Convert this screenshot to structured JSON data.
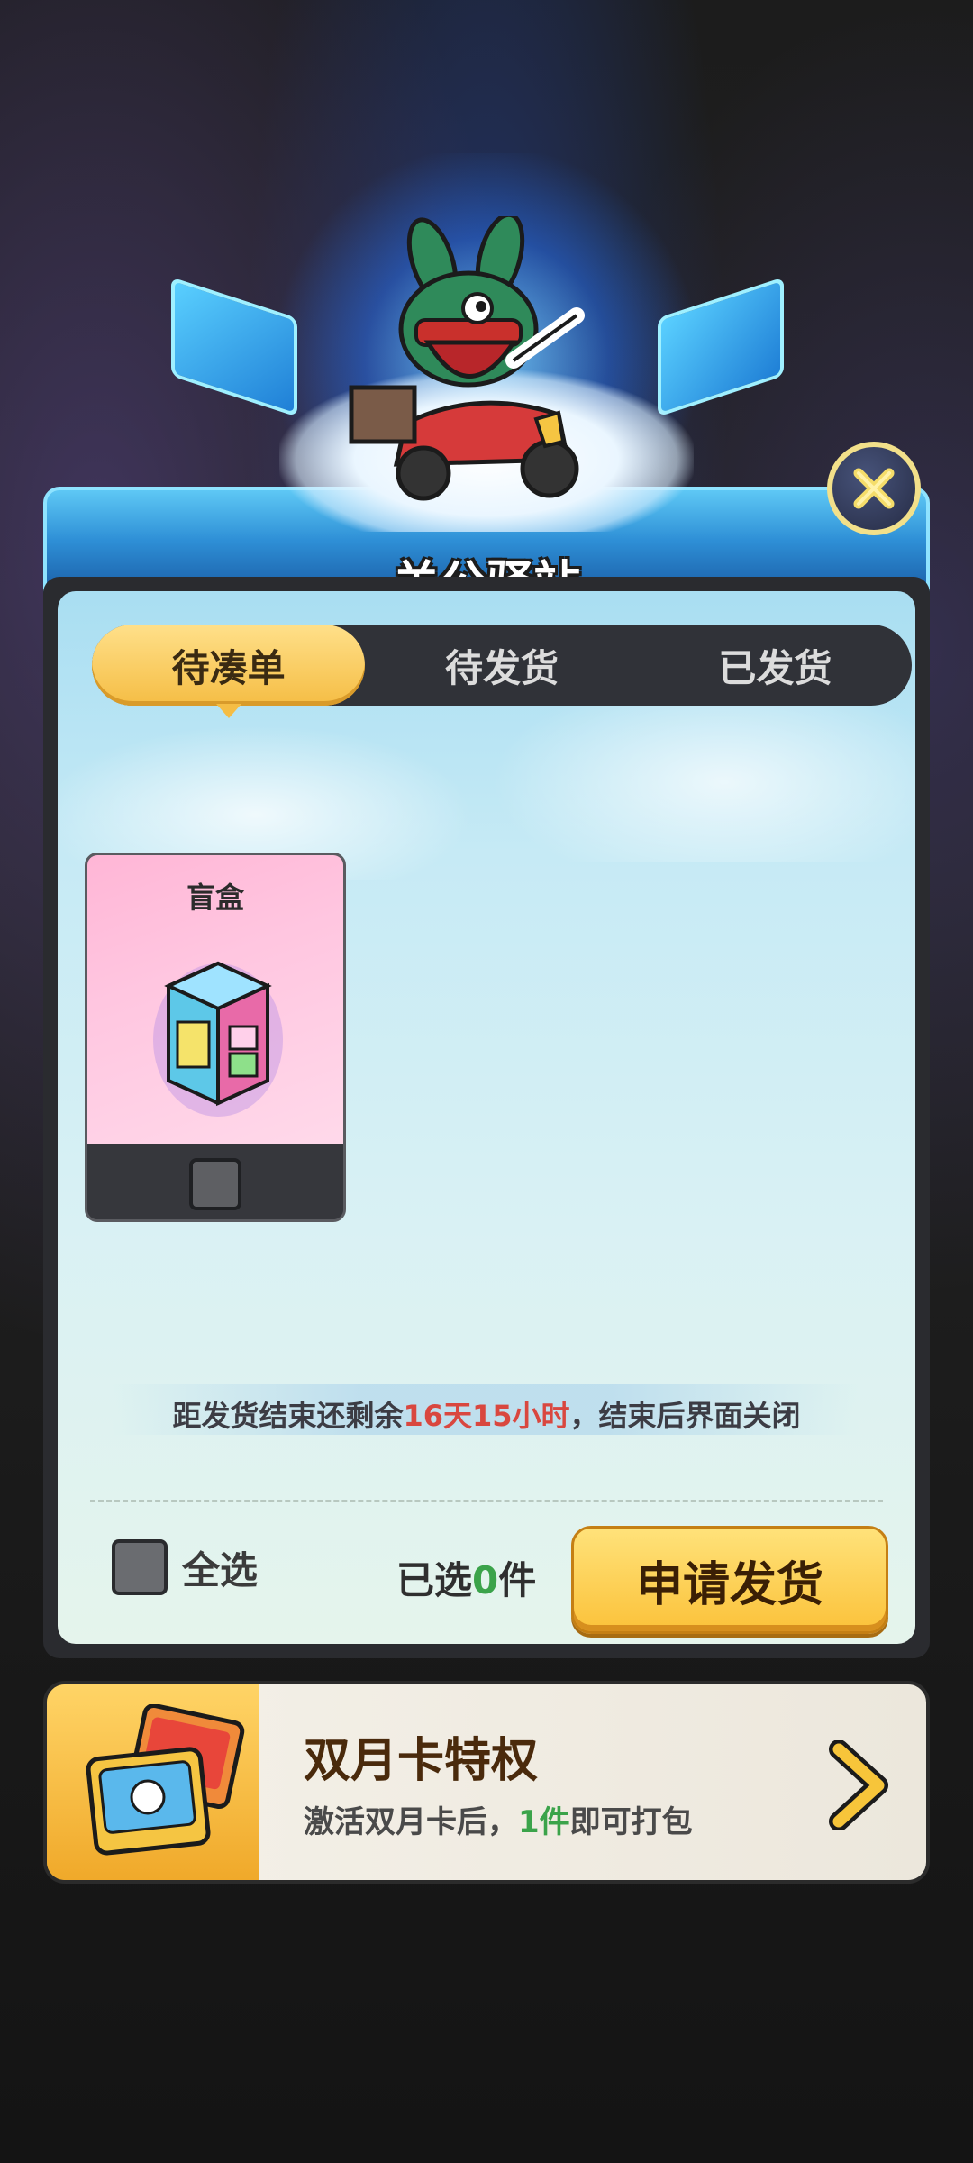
{
  "header": {
    "title": "关公驿站"
  },
  "tabs": [
    {
      "label": "待凑单",
      "active": true
    },
    {
      "label": "待发货",
      "active": false
    },
    {
      "label": "已发货",
      "active": false
    }
  ],
  "items": [
    {
      "label": "盲盒",
      "checked": false
    }
  ],
  "timer": {
    "prefix": "距发货结束还剩余",
    "remaining": "16天15小时",
    "suffix": "，结束后界面关闭"
  },
  "footer": {
    "select_all_label": "全选",
    "selected_prefix": "已选",
    "selected_count": "0",
    "selected_suffix": "件",
    "apply_button": "申请发货"
  },
  "banner": {
    "title": "双月卡特权",
    "sub_prefix": "激活双月卡后，",
    "sub_count": "1件",
    "sub_suffix": "即可打包"
  },
  "colors": {
    "accent_yellow": "#f5bd44",
    "highlight_red": "#d9473f",
    "count_green": "#3ba34a",
    "tab_bar_dark": "#303238"
  },
  "icons": [
    "close-icon",
    "blind-box-icon",
    "chevron-right-icon",
    "card-pack-icon"
  ]
}
